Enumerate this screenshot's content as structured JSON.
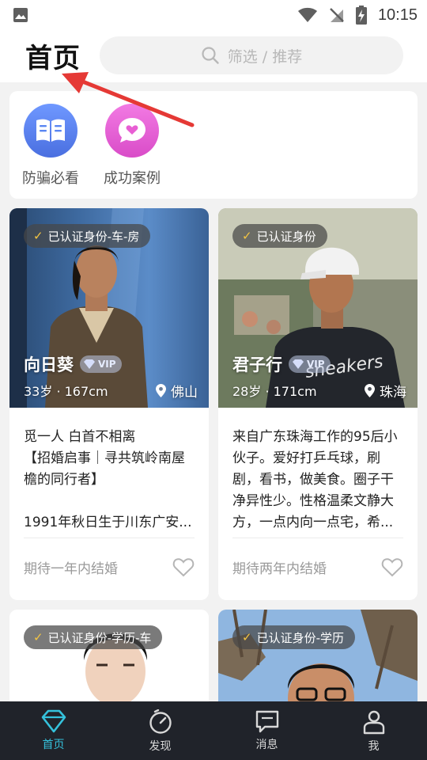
{
  "status_bar": {
    "time": "10:15"
  },
  "header": {
    "title": "首页",
    "search_placeholder": "筛选 / 推荐"
  },
  "quick_links": [
    {
      "label": "防骗必看",
      "icon": "book-icon",
      "color": "#5a86f2"
    },
    {
      "label": "成功案例",
      "icon": "heart-chat-icon",
      "color": "#e85ed4"
    }
  ],
  "profiles": [
    {
      "badge": "已认证身份-车-房",
      "name": "向日葵",
      "vip": "VIP",
      "age_height": "33岁 · 167cm",
      "location": "佛山",
      "bio": [
        "觅一人 白首不相离",
        "【招婚启事｜寻共筑岭南屋檐的同行者】",
        "",
        "1991年秋日生于川东广安..."
      ],
      "expectation": "期待一年内结婚"
    },
    {
      "badge": "已认证身份",
      "name": "君子行",
      "vip": "VIP",
      "age_height": "28岁 · 171cm",
      "location": "珠海",
      "bio": [
        "来自广东珠海工作的95后小伙子。爱好打乒乓球，刷剧，看书，做美食。圈子干净异性少。性格温柔文静大方，一点内向一点宅，希..."
      ],
      "expectation": "期待两年内结婚"
    },
    {
      "badge": "已认证身份-学历-车"
    },
    {
      "badge": "已认证身份-学历"
    }
  ],
  "bottom_nav": [
    {
      "label": "首页",
      "icon": "diamond-icon",
      "active": true
    },
    {
      "label": "发现",
      "icon": "compass-icon",
      "active": false
    },
    {
      "label": "消息",
      "icon": "message-icon",
      "active": false
    },
    {
      "label": "我",
      "icon": "user-icon",
      "active": false
    }
  ],
  "colors": {
    "accent": "#35c2dc",
    "arrow": "#e53935",
    "verify_check": "#f4c542"
  }
}
